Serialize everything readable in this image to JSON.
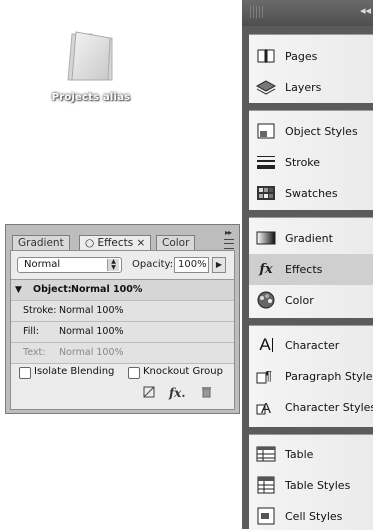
{
  "desktop": {
    "folder_label": "Projects alias"
  },
  "dock": {
    "collapse_glyph": "◂◂",
    "groups": [
      {
        "items": [
          {
            "label": "Pages",
            "icon": "pages-icon"
          },
          {
            "label": "Layers",
            "icon": "layers-icon"
          }
        ]
      },
      {
        "items": [
          {
            "label": "Object Styles",
            "icon": "object-styles-icon"
          },
          {
            "label": "Stroke",
            "icon": "stroke-icon"
          },
          {
            "label": "Swatches",
            "icon": "swatches-icon"
          }
        ]
      },
      {
        "items": [
          {
            "label": "Gradient",
            "icon": "gradient-icon"
          },
          {
            "label": "Effects",
            "icon": "fx-icon",
            "active": true
          },
          {
            "label": "Color",
            "icon": "color-icon"
          }
        ]
      },
      {
        "items": [
          {
            "label": "Character",
            "icon": "character-icon"
          },
          {
            "label": "Paragraph Styles",
            "icon": "paragraph-styles-icon"
          },
          {
            "label": "Character Styles",
            "icon": "character-styles-icon"
          }
        ]
      },
      {
        "items": [
          {
            "label": "Table",
            "icon": "table-icon"
          },
          {
            "label": "Table Styles",
            "icon": "table-styles-icon"
          },
          {
            "label": "Cell Styles",
            "icon": "cell-styles-icon"
          }
        ]
      }
    ]
  },
  "effects_panel": {
    "tabs": [
      {
        "label": "Gradient"
      },
      {
        "label": "○ Effects ×",
        "active": true
      },
      {
        "label": "Color"
      }
    ],
    "blend_mode": "Normal",
    "opacity_label": "Opacity:",
    "opacity_value": "100%",
    "rows": [
      {
        "key": "Object:",
        "value": "Normal 100%"
      },
      {
        "key": "Stroke:",
        "value": "Normal 100%"
      },
      {
        "key": "Fill:",
        "value": "Normal 100%"
      },
      {
        "key": "Text:",
        "value": "Normal 100%"
      }
    ],
    "isolate_label": "Isolate Blending",
    "knockout_label": "Knockout Group",
    "fx_label": "fx."
  }
}
